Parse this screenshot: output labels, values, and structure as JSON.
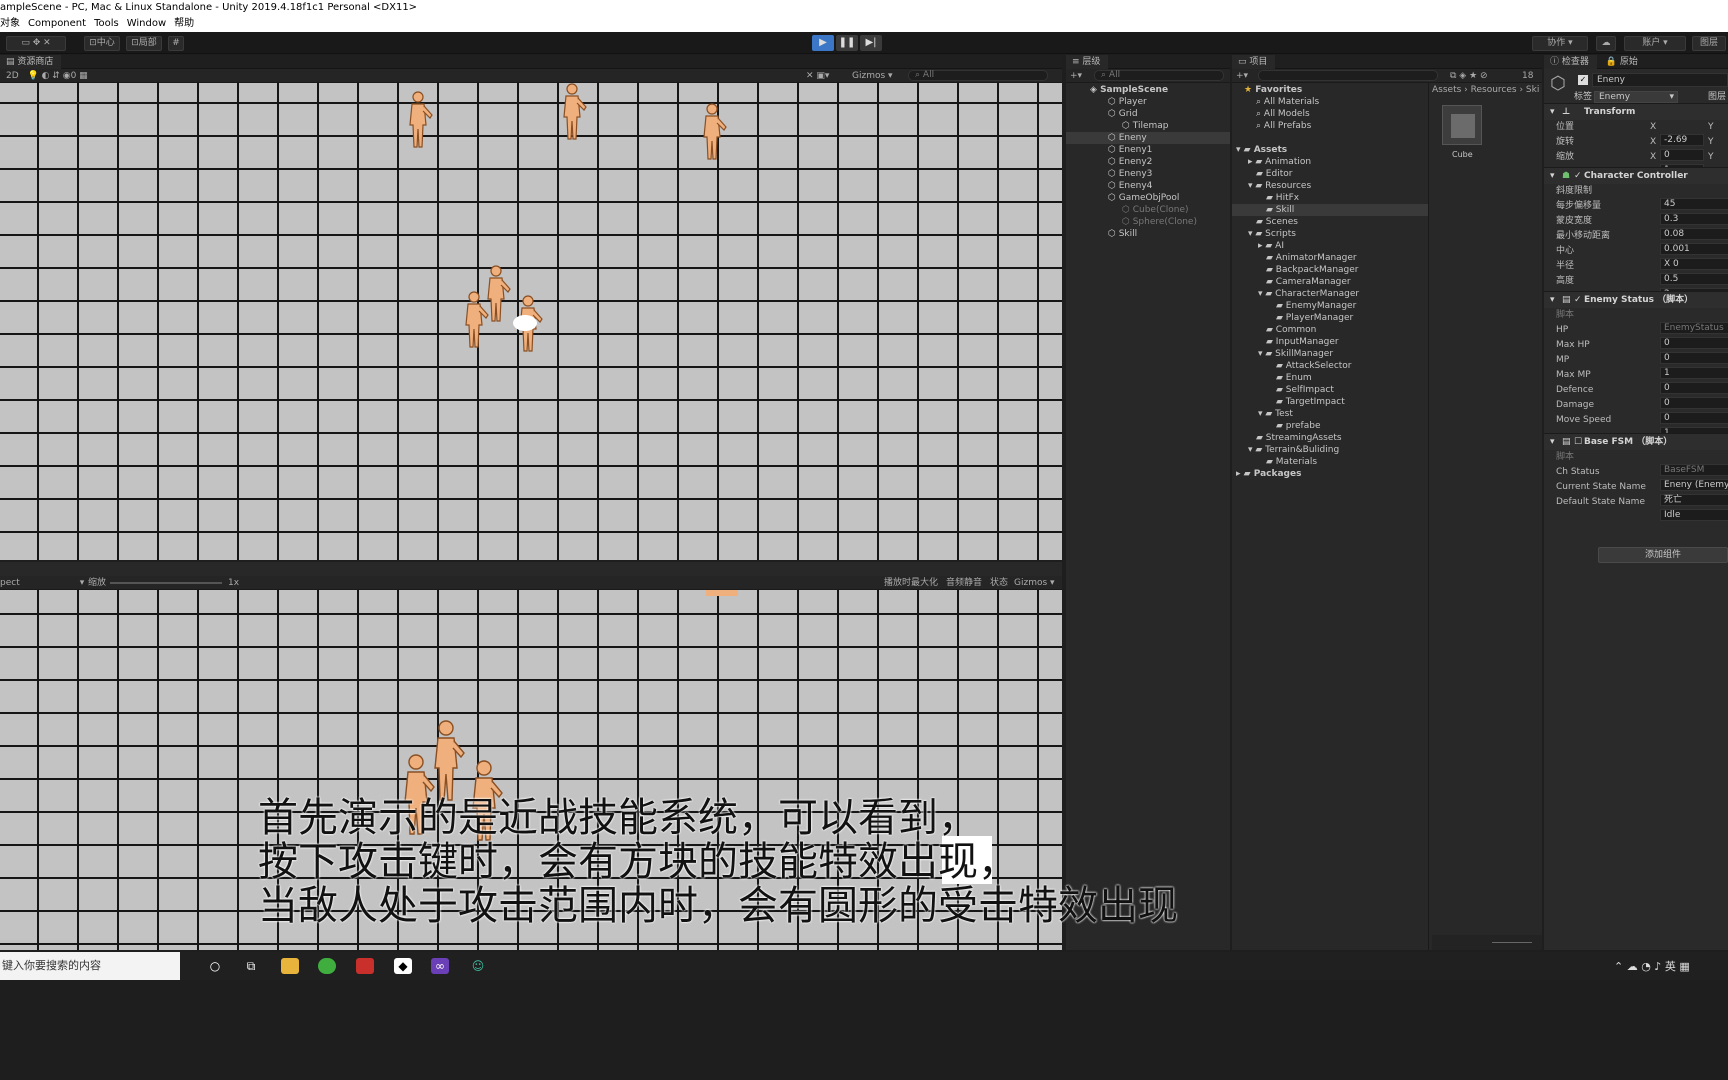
{
  "window_title": "ampleScene - PC, Mac & Linux Standalone - Unity 2019.4.18f1c1 Personal <DX11>",
  "menu": [
    "对象",
    "Component",
    "Tools",
    "Window",
    "帮助"
  ],
  "toolbar": {
    "pivot_label": "中心",
    "local_label": "局部",
    "collab_label": "协作",
    "account_label": "账户",
    "layout_label": "图层"
  },
  "scene_view": {
    "tab_label": "资源商店",
    "mode_2d": "2D",
    "gizmos_label": "Gizmos",
    "search_placeholder": "All"
  },
  "game_view": {
    "aspect_label": "pect",
    "scale_label": "缩放",
    "scale_value": "1x",
    "maximize_label": "播放时最大化",
    "mute_label": "音频静音",
    "stats_label": "状态",
    "gizmos_label": "Gizmos"
  },
  "hierarchy": {
    "tab_label": "层级",
    "search_placeholder": "All",
    "scene_name": "SampleScene",
    "items": [
      "Player",
      "Grid",
      "Tilemap",
      "Eneny",
      "Eneny1",
      "Eneny2",
      "Eneny3",
      "Eneny4",
      "GameObjPool",
      "Cube(Clone)",
      "Sphere(Clone)",
      "Skill"
    ]
  },
  "project": {
    "tab_label": "项目",
    "favorites_label": "Favorites",
    "favorites": [
      "All Materials",
      "All Models",
      "All Prefabs"
    ],
    "assets_label": "Assets",
    "tree": [
      "Animation",
      "Editor",
      "Resources",
      "HitFx",
      "Skill",
      "Scenes",
      "Scripts",
      "AI",
      "AnimatorManager",
      "BackpackManager",
      "CameraManager",
      "CharacterManager",
      "EnemyManager",
      "PlayerManager",
      "Common",
      "InputManager",
      "SkillManager",
      "AttackSelector",
      "Enum",
      "SelfImpact",
      "TargetImpact",
      "Test",
      "prefabe",
      "StreamingAssets",
      "Terrain&Buliding",
      "Materials"
    ],
    "packages_label": "Packages",
    "breadcrumb": [
      "Assets",
      "Resources",
      "Ski"
    ],
    "asset_name": "Cube",
    "count_badge": "18"
  },
  "inspector": {
    "tab_label": "检查器",
    "tab2_label": "原始",
    "object_name": "Eneny",
    "tag_label": "标签",
    "tag_value": "Enemy",
    "layer_label": "图层",
    "transform": {
      "title": "Transform",
      "position_label": "位置",
      "position_x": "-2.69",
      "rotation_label": "旋转",
      "rotation_x": "0",
      "scale_label": "缩放",
      "scale_x": "1"
    },
    "char_controller": {
      "title": "Character Controller",
      "rows": [
        {
          "label": "斜度限制",
          "value": "45"
        },
        {
          "label": "每步偏移量",
          "value": "0.3"
        },
        {
          "label": "蒙皮宽度",
          "value": "0.08"
        },
        {
          "label": "最小移动距离",
          "value": "0.001"
        },
        {
          "label": "中心",
          "value": "X 0"
        },
        {
          "label": "半径",
          "value": "0.5"
        },
        {
          "label": "高度",
          "value": "2"
        }
      ]
    },
    "enemy_status": {
      "title": "Enemy Status （脚本）",
      "script_label": "脚本",
      "script_value": "EnemyStatus",
      "rows": [
        {
          "label": "HP",
          "value": "0"
        },
        {
          "label": "Max HP",
          "value": "0"
        },
        {
          "label": "MP",
          "value": "1"
        },
        {
          "label": "Max MP",
          "value": "0"
        },
        {
          "label": "Defence",
          "value": "0"
        },
        {
          "label": "Damage",
          "value": "0"
        },
        {
          "label": "Move Speed",
          "value": "1"
        }
      ]
    },
    "base_fsm": {
      "title": "Base FSM （脚本）",
      "rows": [
        {
          "label": "脚本",
          "value": "BaseFSM"
        },
        {
          "label": "Ch Status",
          "value": "Eneny (Enemy"
        },
        {
          "label": "Current State Name",
          "value": "死亡"
        },
        {
          "label": "Default State Name",
          "value": "Idle"
        }
      ]
    },
    "add_component": "添加组件"
  },
  "subtitles": [
    "首先演示的是近战技能系统，可以看到，",
    "按下攻击键时，会有方块的技能特效出现，",
    "当敌人处于攻击范围内时，会有圆形的受击特效出现"
  ],
  "taskbar": {
    "search_placeholder": "键入你要搜索的内容",
    "ime": "英"
  }
}
